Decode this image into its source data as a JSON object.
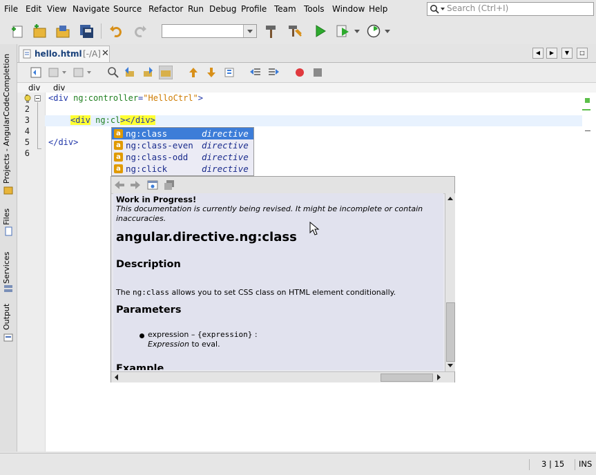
{
  "menu": [
    "File",
    "Edit",
    "View",
    "Navigate",
    "Source",
    "Refactor",
    "Run",
    "Debug",
    "Profile",
    "Team",
    "Tools",
    "Window",
    "Help"
  ],
  "search": {
    "placeholder": "Search (Ctrl+I)"
  },
  "sidebar": {
    "tabs": [
      "Projects - AngularCodeCompletion",
      "Files",
      "Services",
      "Output"
    ]
  },
  "editor_tab": {
    "filename": "hello.html",
    "modifier": "[-/A]"
  },
  "breadcrumb": [
    "div",
    "div"
  ],
  "code": {
    "line_numbers": [
      "1",
      "2",
      "3",
      "4",
      "5",
      "6"
    ],
    "line1": {
      "open": "<div ",
      "attr": "ng:controller",
      "eq": "=",
      "value": "\"HelloCtrl\"",
      "close": ">"
    },
    "line3": {
      "tag_open": "<div",
      "space": " ",
      "attr": "ng:cl",
      "tag_close": "></div>"
    },
    "line5": {
      "close": "</div>"
    }
  },
  "completion": {
    "items": [
      {
        "name": "ng:class",
        "kind": "directive"
      },
      {
        "name": "ng:class-even",
        "kind": "directive"
      },
      {
        "name": "ng:class-odd",
        "kind": "directive"
      },
      {
        "name": "ng:click",
        "kind": "directive"
      }
    ],
    "selected_index": 0
  },
  "doc": {
    "wip_title": "Work in Progress!",
    "wip_text": "This documentation is currently being revised. It might be incomplete or contain inaccuracies.",
    "heading": "angular.directive.ng:class",
    "description_title": "Description",
    "description_code": "ng:class",
    "description_pre": "The ",
    "description_post": " allows you to set CSS class on HTML element conditionally.",
    "parameters_title": "Parameters",
    "param_name": "expression",
    "param_sep": " – ",
    "param_type": "{expression}",
    "param_colon": " :",
    "param_desc_em": "Expression",
    "param_desc_rest": " to eval.",
    "example_title": "Example"
  },
  "status": {
    "position": "3 | 15",
    "mode": "INS"
  }
}
